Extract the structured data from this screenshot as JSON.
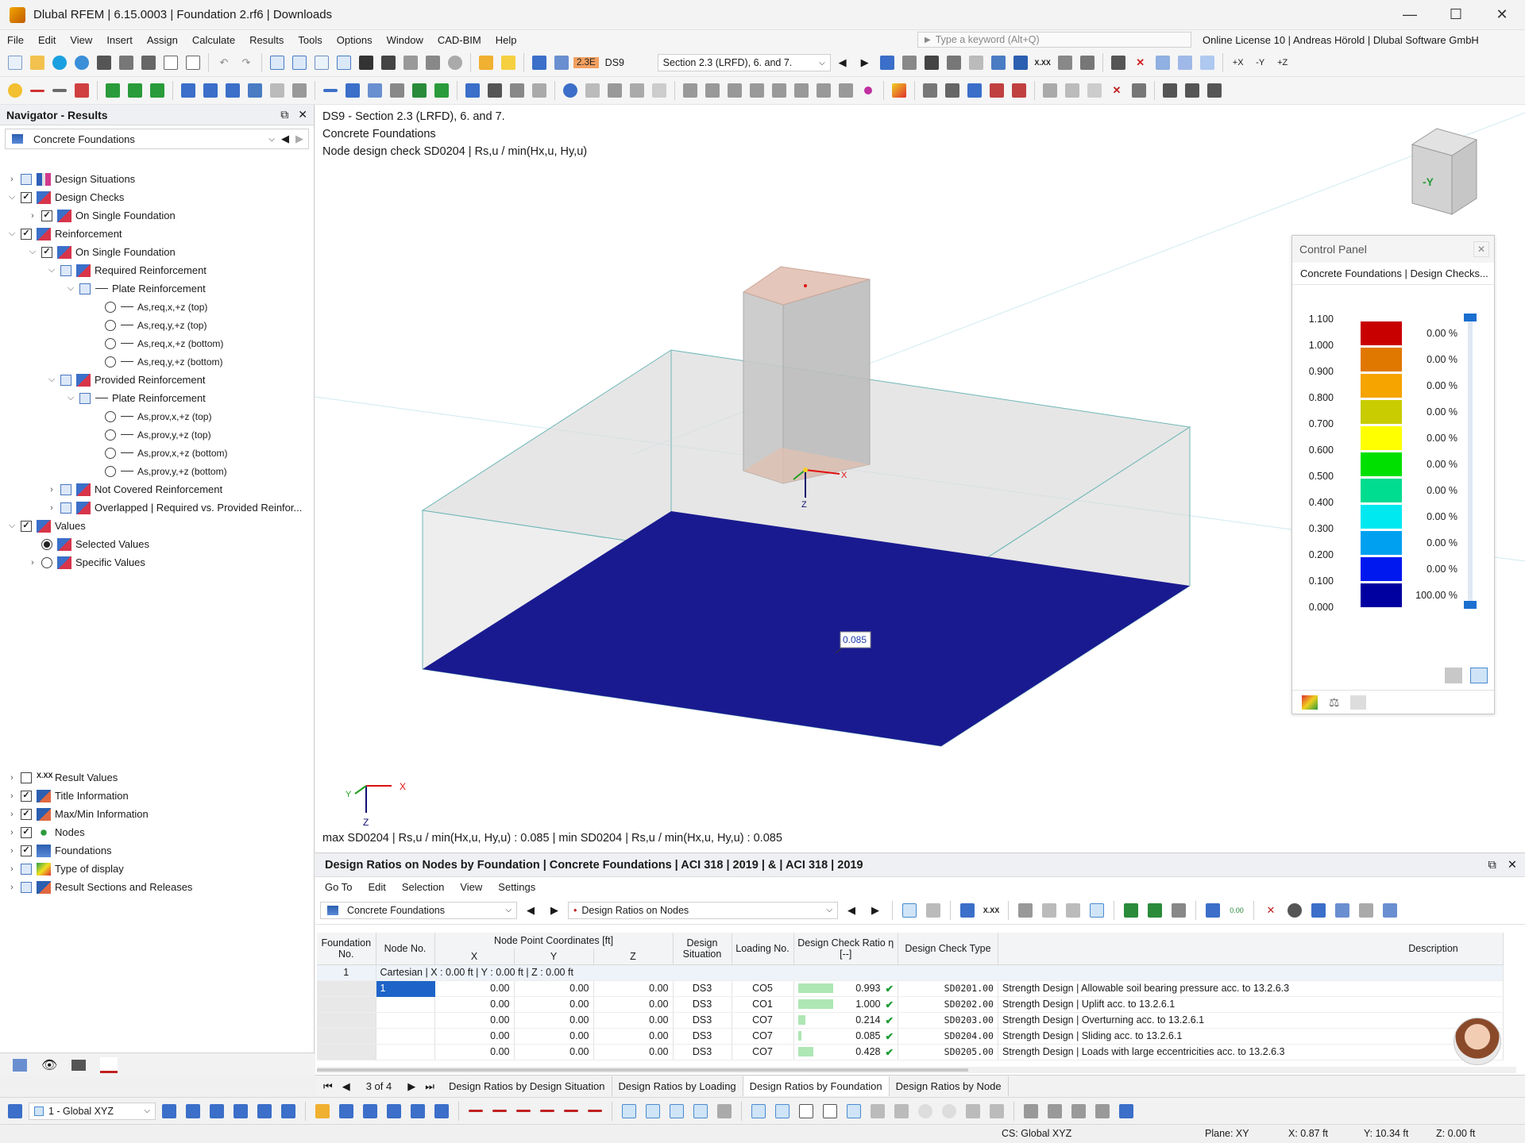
{
  "window": {
    "title": "Dlubal RFEM | 6.15.0003 | Foundation 2.rf6 | Downloads",
    "controls": [
      "—",
      "☐",
      "✕"
    ]
  },
  "menu": {
    "items": [
      "File",
      "Edit",
      "View",
      "Insert",
      "Assign",
      "Calculate",
      "Results",
      "Tools",
      "Options",
      "Window",
      "CAD-BIM",
      "Help"
    ],
    "search_placeholder": "Type a keyword (Alt+Q)",
    "license": "Online License 10 | Andreas Hörold | Dlubal Software GmbH"
  },
  "toolbar": {
    "ds_badge": "2.3E",
    "ds_name": "DS9",
    "ds_desc": "Section 2.3 (LRFD), 6. and 7."
  },
  "navigator": {
    "title": "Navigator - Results",
    "selector": "Concrete Foundations",
    "tree": [
      {
        "label": "Design Situations"
      },
      {
        "label": "Design Checks"
      },
      {
        "label": "On Single Foundation"
      },
      {
        "label": "Reinforcement"
      },
      {
        "label": "On Single Foundation"
      },
      {
        "label": "Required Reinforcement"
      },
      {
        "label": "Plate Reinforcement"
      },
      {
        "label": "As,req,x,+z (top)"
      },
      {
        "label": "As,req,y,+z (top)"
      },
      {
        "label": "As,req,x,+z (bottom)"
      },
      {
        "label": "As,req,y,+z (bottom)"
      },
      {
        "label": "Provided Reinforcement"
      },
      {
        "label": "Plate Reinforcement"
      },
      {
        "label": "As,prov,x,+z (top)"
      },
      {
        "label": "As,prov,y,+z (top)"
      },
      {
        "label": "As,prov,x,+z (bottom)"
      },
      {
        "label": "As,prov,y,+z (bottom)"
      },
      {
        "label": "Not Covered Reinforcement"
      },
      {
        "label": "Overlapped | Required vs. Provided Reinfor..."
      },
      {
        "label": "Values"
      },
      {
        "label": "Selected Values"
      },
      {
        "label": "Specific Values"
      }
    ],
    "display_tree": [
      {
        "label": "Result Values"
      },
      {
        "label": "Title Information"
      },
      {
        "label": "Max/Min Information"
      },
      {
        "label": "Nodes"
      },
      {
        "label": "Foundations"
      },
      {
        "label": "Type of display"
      },
      {
        "label": "Result Sections and Releases"
      }
    ]
  },
  "viewport": {
    "line1": "DS9 - Section 2.3 (LRFD), 6. and 7.",
    "line2": "Concrete Foundations",
    "line3": "Node design check SD0204 | Rs,u / min(Hx,u, Hy,u)",
    "value_label": "0.085",
    "axis_x": "X",
    "axis_y": "Y",
    "axis_z": "Z",
    "cube_label": "-Y",
    "maxmin": "max SD0204 | Rs,u / min(Hx,u, Hy,u) : 0.085 | min SD0204 | Rs,u / min(Hx,u, Hy,u) : 0.085"
  },
  "control_panel": {
    "title": "Control Panel",
    "subtitle": "Concrete Foundations | Design Checks...",
    "scale": [
      {
        "label": "1.100",
        "color": "#c80000",
        "pct": "0.00 %"
      },
      {
        "label": "1.000",
        "color": "#e07800",
        "pct": "0.00 %"
      },
      {
        "label": "0.900",
        "color": "#f5a400",
        "pct": "0.00 %"
      },
      {
        "label": "0.800",
        "color": "#c8cc00",
        "pct": "0.00 %"
      },
      {
        "label": "0.700",
        "color": "#ffff00",
        "pct": "0.00 %"
      },
      {
        "label": "0.600",
        "color": "#00e000",
        "pct": "0.00 %"
      },
      {
        "label": "0.500",
        "color": "#00dc90",
        "pct": "0.00 %"
      },
      {
        "label": "0.400",
        "color": "#00e8f0",
        "pct": "0.00 %"
      },
      {
        "label": "0.300",
        "color": "#00a0f0",
        "pct": "0.00 %"
      },
      {
        "label": "0.200",
        "color": "#0018f0",
        "pct": "100.00 %"
      },
      {
        "label": "0.100",
        "color": "#0000a0",
        "pct": ""
      },
      {
        "label": "0.000",
        "color": "",
        "pct": ""
      }
    ]
  },
  "table": {
    "title": "Design Ratios on Nodes by Foundation | Concrete Foundations | ACI 318 | 2019 | & | ACI 318 | 2019",
    "menu": [
      "Go To",
      "Edit",
      "Selection",
      "View",
      "Settings"
    ],
    "combo_left": "Concrete Foundations",
    "combo_right": "Design Ratios on Nodes",
    "headers": {
      "foundation": "Foundation No.",
      "node": "Node No.",
      "coords": "Node Point Coordinates [ft]",
      "x": "X",
      "y": "Y",
      "z": "Z",
      "situation": "Design Situation",
      "loading": "Loading No.",
      "ratio": "Design Check Ratio η [--]",
      "type": "Design Check Type",
      "desc": "Description"
    },
    "group": {
      "foundation": "1",
      "cs": "Cartesian | X : 0.00 ft | Y : 0.00 ft | Z : 0.00 ft"
    },
    "rows": [
      {
        "node": "1",
        "x": "0.00",
        "y": "0.00",
        "z": "0.00",
        "ds": "DS3",
        "lc": "CO5",
        "ratio": "0.993",
        "fill": 0.993,
        "type": "SD0201.00",
        "desc": "Strength Design | Allowable soil bearing pressure acc. to 13.2.6.3"
      },
      {
        "node": "",
        "x": "0.00",
        "y": "0.00",
        "z": "0.00",
        "ds": "DS3",
        "lc": "CO1",
        "ratio": "1.000",
        "fill": 1.0,
        "type": "SD0202.00",
        "desc": "Strength Design | Uplift acc. to 13.2.6.1"
      },
      {
        "node": "",
        "x": "0.00",
        "y": "0.00",
        "z": "0.00",
        "ds": "DS3",
        "lc": "CO7",
        "ratio": "0.214",
        "fill": 0.214,
        "type": "SD0203.00",
        "desc": "Strength Design | Overturning acc. to 13.2.6.1"
      },
      {
        "node": "",
        "x": "0.00",
        "y": "0.00",
        "z": "0.00",
        "ds": "DS3",
        "lc": "CO7",
        "ratio": "0.085",
        "fill": 0.085,
        "type": "SD0204.00",
        "desc": "Strength Design | Sliding acc. to 13.2.6.1"
      },
      {
        "node": "",
        "x": "0.00",
        "y": "0.00",
        "z": "0.00",
        "ds": "DS3",
        "lc": "CO7",
        "ratio": "0.428",
        "fill": 0.428,
        "type": "SD0205.00",
        "desc": "Strength Design | Loads with large eccentricities acc. to 13.2.6.3"
      }
    ],
    "pager": "3 of 4",
    "tabs": [
      "Design Ratios by Design Situation",
      "Design Ratios by Loading",
      "Design Ratios by Foundation",
      "Design Ratios by Node"
    ]
  },
  "bottom": {
    "cs_combo": "1 - Global XYZ"
  },
  "status": {
    "cs": "CS: Global XYZ",
    "plane": "Plane: XY",
    "x": "X: 0.87 ft",
    "y": "Y: 10.34 ft",
    "z": "Z: 0.00 ft"
  }
}
